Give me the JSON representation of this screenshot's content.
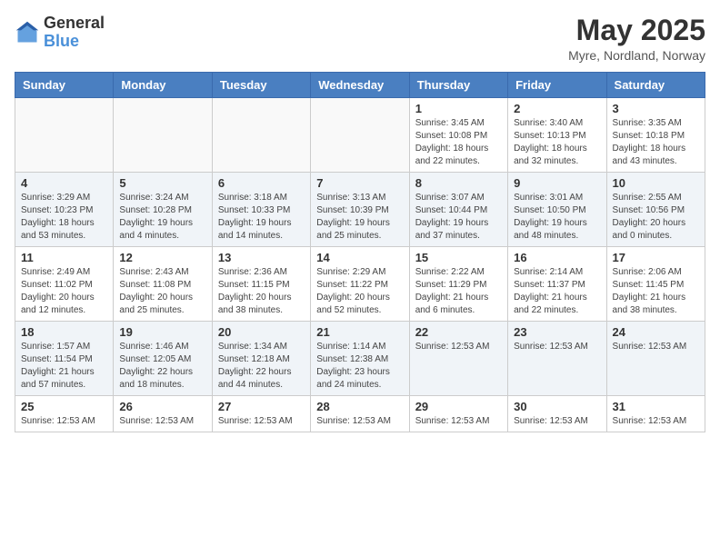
{
  "header": {
    "logo_general": "General",
    "logo_blue": "Blue",
    "month_title": "May 2025",
    "location": "Myre, Nordland, Norway"
  },
  "weekdays": [
    "Sunday",
    "Monday",
    "Tuesday",
    "Wednesday",
    "Thursday",
    "Friday",
    "Saturday"
  ],
  "weeks": [
    [
      {
        "day": "",
        "info": ""
      },
      {
        "day": "",
        "info": ""
      },
      {
        "day": "",
        "info": ""
      },
      {
        "day": "",
        "info": ""
      },
      {
        "day": "1",
        "info": "Sunrise: 3:45 AM\nSunset: 10:08 PM\nDaylight: 18 hours\nand 22 minutes."
      },
      {
        "day": "2",
        "info": "Sunrise: 3:40 AM\nSunset: 10:13 PM\nDaylight: 18 hours\nand 32 minutes."
      },
      {
        "day": "3",
        "info": "Sunrise: 3:35 AM\nSunset: 10:18 PM\nDaylight: 18 hours\nand 43 minutes."
      }
    ],
    [
      {
        "day": "4",
        "info": "Sunrise: 3:29 AM\nSunset: 10:23 PM\nDaylight: 18 hours\nand 53 minutes."
      },
      {
        "day": "5",
        "info": "Sunrise: 3:24 AM\nSunset: 10:28 PM\nDaylight: 19 hours\nand 4 minutes."
      },
      {
        "day": "6",
        "info": "Sunrise: 3:18 AM\nSunset: 10:33 PM\nDaylight: 19 hours\nand 14 minutes."
      },
      {
        "day": "7",
        "info": "Sunrise: 3:13 AM\nSunset: 10:39 PM\nDaylight: 19 hours\nand 25 minutes."
      },
      {
        "day": "8",
        "info": "Sunrise: 3:07 AM\nSunset: 10:44 PM\nDaylight: 19 hours\nand 37 minutes."
      },
      {
        "day": "9",
        "info": "Sunrise: 3:01 AM\nSunset: 10:50 PM\nDaylight: 19 hours\nand 48 minutes."
      },
      {
        "day": "10",
        "info": "Sunrise: 2:55 AM\nSunset: 10:56 PM\nDaylight: 20 hours\nand 0 minutes."
      }
    ],
    [
      {
        "day": "11",
        "info": "Sunrise: 2:49 AM\nSunset: 11:02 PM\nDaylight: 20 hours\nand 12 minutes."
      },
      {
        "day": "12",
        "info": "Sunrise: 2:43 AM\nSunset: 11:08 PM\nDaylight: 20 hours\nand 25 minutes."
      },
      {
        "day": "13",
        "info": "Sunrise: 2:36 AM\nSunset: 11:15 PM\nDaylight: 20 hours\nand 38 minutes."
      },
      {
        "day": "14",
        "info": "Sunrise: 2:29 AM\nSunset: 11:22 PM\nDaylight: 20 hours\nand 52 minutes."
      },
      {
        "day": "15",
        "info": "Sunrise: 2:22 AM\nSunset: 11:29 PM\nDaylight: 21 hours\nand 6 minutes."
      },
      {
        "day": "16",
        "info": "Sunrise: 2:14 AM\nSunset: 11:37 PM\nDaylight: 21 hours\nand 22 minutes."
      },
      {
        "day": "17",
        "info": "Sunrise: 2:06 AM\nSunset: 11:45 PM\nDaylight: 21 hours\nand 38 minutes."
      }
    ],
    [
      {
        "day": "18",
        "info": "Sunrise: 1:57 AM\nSunset: 11:54 PM\nDaylight: 21 hours\nand 57 minutes."
      },
      {
        "day": "19",
        "info": "Sunrise: 1:46 AM\nSunset: 12:05 AM\nDaylight: 22 hours\nand 18 minutes."
      },
      {
        "day": "20",
        "info": "Sunrise: 1:34 AM\nSunset: 12:18 AM\nDaylight: 22 hours\nand 44 minutes."
      },
      {
        "day": "21",
        "info": "Sunrise: 1:14 AM\nSunset: 12:38 AM\nDaylight: 23 hours\nand 24 minutes."
      },
      {
        "day": "22",
        "info": "Sunrise: 12:53 AM"
      },
      {
        "day": "23",
        "info": "Sunrise: 12:53 AM"
      },
      {
        "day": "24",
        "info": "Sunrise: 12:53 AM"
      }
    ],
    [
      {
        "day": "25",
        "info": "Sunrise: 12:53 AM"
      },
      {
        "day": "26",
        "info": "Sunrise: 12:53 AM"
      },
      {
        "day": "27",
        "info": "Sunrise: 12:53 AM"
      },
      {
        "day": "28",
        "info": "Sunrise: 12:53 AM"
      },
      {
        "day": "29",
        "info": "Sunrise: 12:53 AM"
      },
      {
        "day": "30",
        "info": "Sunrise: 12:53 AM"
      },
      {
        "day": "31",
        "info": "Sunrise: 12:53 AM"
      }
    ]
  ]
}
